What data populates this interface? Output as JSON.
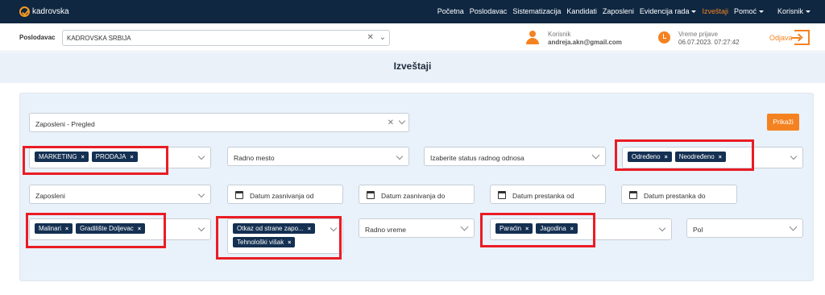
{
  "topnav": {
    "brand": "kadrovska",
    "items": [
      "Početna",
      "Poslodavac",
      "Sistematizacija",
      "Kandidati",
      "Zaposleni",
      "Evidencija rada",
      "Izveštaji",
      "Pomoć",
      "Korisnik"
    ],
    "active": "Izveštaji",
    "accent": "#f58220",
    "bg": "#0f2741"
  },
  "subbar": {
    "employer_label": "Poslodavac",
    "employer_value": "KADROVSKA SRBIJA",
    "user_label": "Korisnik",
    "user_value": "andreja.akn@gmail.com",
    "login_label": "Vreme prijave",
    "login_value": "06.07.2023. 07:27:42",
    "logout_label": "Odjava"
  },
  "page": {
    "title": "Izveštaji"
  },
  "filters": {
    "report_type": "Zaposleni - Pregled",
    "show_button": "Prikaži",
    "org_units": [
      "MARKETING",
      "PRODAJA"
    ],
    "work_position_placeholder": "Radno mesto",
    "employment_status_placeholder": "Izaberite status radnog odnosa",
    "contract_types": [
      "Određeno",
      "Neodređeno"
    ],
    "employees_placeholder": "Zaposleni",
    "date_hire_from": "Datum zasnivanja od",
    "date_hire_to": "Datum zasnivanja do",
    "date_end_from": "Datum prestanka od",
    "date_end_to": "Datum prestanka do",
    "locations": [
      "Malinari",
      "Gradilište Doljevac"
    ],
    "termination_reasons": [
      "Otkaz od strane zapo...",
      "Tehnološki višak"
    ],
    "work_time_placeholder": "Radno vreme",
    "cities": [
      "Paraćin",
      "Jagodina"
    ],
    "gender_placeholder": "Pol"
  }
}
